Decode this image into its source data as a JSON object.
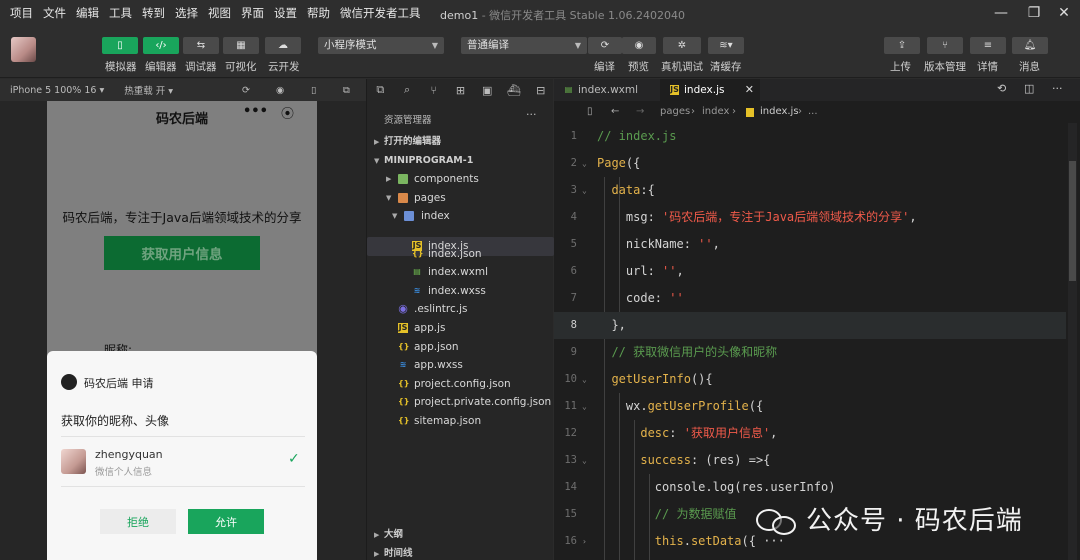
{
  "menu": [
    "项目",
    "文件",
    "编辑",
    "工具",
    "转到",
    "选择",
    "视图",
    "界面",
    "设置",
    "帮助",
    "微信开发者工具"
  ],
  "window": {
    "title": "demo1",
    "subtitle": " - 微信开发者工具 Stable 1.06.2402040"
  },
  "toolbar": {
    "simulator": "模拟器",
    "editor": "编辑器",
    "debugger": "调试器",
    "visual": "可视化",
    "cloud": "云开发",
    "mode_select": "小程序模式",
    "compile_select": "普通编译",
    "compile": "编译",
    "preview": "预览",
    "device_debug": "真机调试",
    "clear_cache": "清缓存",
    "upload": "上传",
    "version": "版本管理",
    "details": "详情",
    "messages": "消息"
  },
  "simbar": {
    "device": "iPhone 5 100% 16",
    "hotreload": "热重载 开"
  },
  "phone": {
    "title": "码农后端",
    "message": "码农后端，专注于Java后端领域技术的分享",
    "get_button": "获取用户信息",
    "nickname_label": "昵称:",
    "auth": {
      "app_title": "码农后端 申请",
      "request": "获取你的昵称、头像",
      "user_name": "zhengyquan",
      "user_sub": "微信个人信息",
      "reject": "拒绝",
      "allow": "允许"
    }
  },
  "explorer": {
    "header": "资源管理器",
    "open_editors": "打开的编辑器",
    "project": "MINIPROGRAM-1",
    "files": {
      "components": "components",
      "pages": "pages",
      "index_folder": "index",
      "index_js": "index.js",
      "index_json": "index.json",
      "index_wxml": "index.wxml",
      "index_wxss": "index.wxss",
      "eslintrc": ".eslintrc.js",
      "app_js": "app.js",
      "app_json": "app.json",
      "app_wxss": "app.wxss",
      "project_config": "project.config.json",
      "project_private": "project.private.config.json",
      "sitemap": "sitemap.json"
    },
    "outline": "大纲",
    "timeline": "时间线"
  },
  "editor": {
    "tab1": "index.wxml",
    "tab2": "index.js",
    "breadcrumb": {
      "pages": "pages",
      "index": "index",
      "file": "index.js",
      "more": "..."
    },
    "current_line": 8,
    "lines": [
      {
        "n": "1",
        "c": "// index.js"
      },
      {
        "n": "2",
        "c": "Page({"
      },
      {
        "n": "3",
        "c": "  data:{"
      },
      {
        "n": "4",
        "c": "    msg: '码农后端，专注于Java后端领域技术的分享',"
      },
      {
        "n": "5",
        "c": "    nickName: '',"
      },
      {
        "n": "6",
        "c": "    url: '',"
      },
      {
        "n": "7",
        "c": "    code: ''"
      },
      {
        "n": "8",
        "c": "  },"
      },
      {
        "n": "9",
        "c": "  // 获取微信用户的头像和昵称"
      },
      {
        "n": "10",
        "c": "  getUserInfo(){"
      },
      {
        "n": "11",
        "c": "    wx.getUserProfile({"
      },
      {
        "n": "12",
        "c": "      desc: '获取用户信息',"
      },
      {
        "n": "13",
        "c": "      success: (res) =>{"
      },
      {
        "n": "14",
        "c": "        console.log(res.userInfo)"
      },
      {
        "n": "15",
        "c": "        // 为数据赋值"
      },
      {
        "n": "16",
        "c": "        this.setData({ ···"
      }
    ]
  },
  "watermark": "公众号 · 码农后端"
}
